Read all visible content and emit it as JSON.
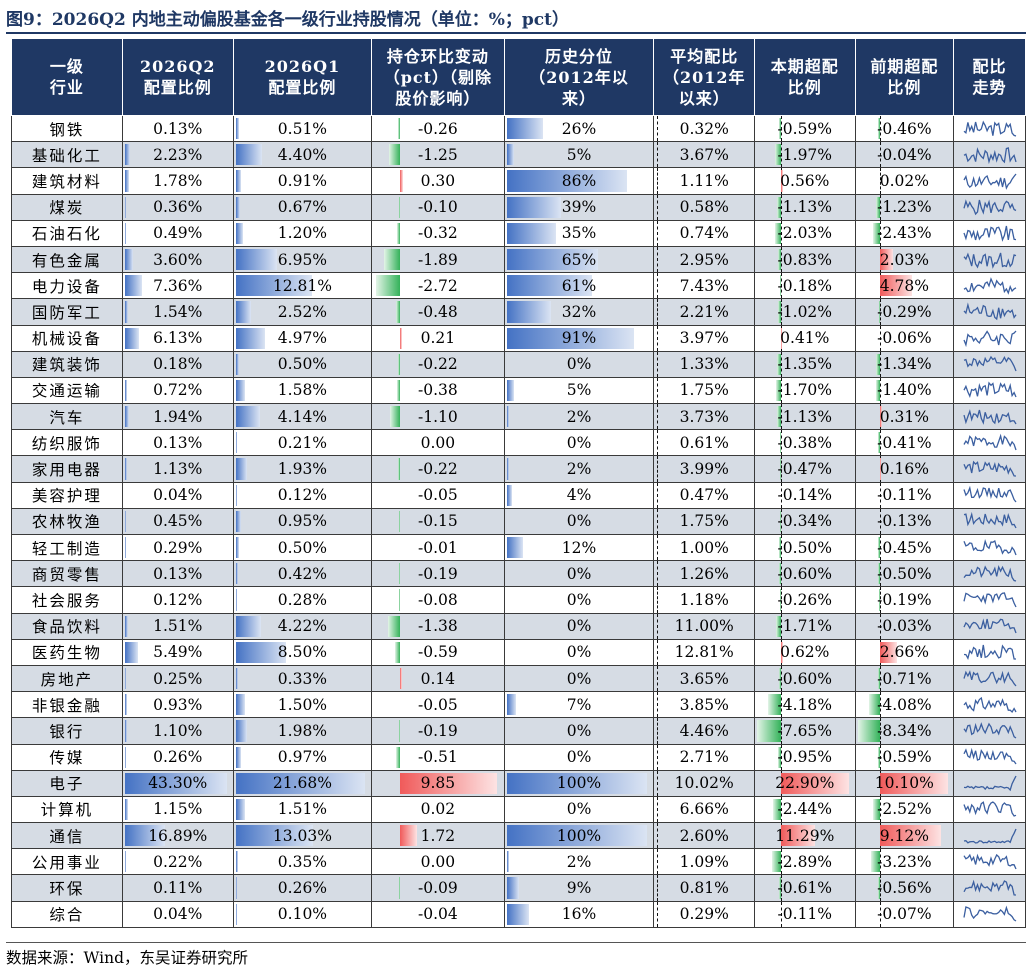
{
  "title": "图9：2026Q2 内地主动偏股基金各一级行业持股情况（单位：%；pct）",
  "source": "数据来源：Wind，东吴证券研究所",
  "headers": [
    "一级\n行业",
    "2026Q2\n配置比例",
    "2026Q1\n配置比例",
    "持仓环比变动\n（pct）（剔除\n股价影响）",
    "历史分位\n（2012年以\n来）",
    "平均配比\n（2012年\n以来）",
    "本期超配\n比例",
    "前期超配\n比例",
    "配比\n走势"
  ],
  "colors": {
    "header": "#1f3864",
    "alt_row": "#d6dce4",
    "bar_blue": "#4472c4",
    "bar_green": "#34b25a",
    "bar_red": "#f05a5a",
    "spark": "#3b5fa0"
  },
  "rows": [
    {
      "industry": "钢铁",
      "q2": "0.13%",
      "q1": "0.51%",
      "chg": "-0.26",
      "pct": "26%",
      "avg": "0.32%",
      "over": "-0.59%",
      "prev": "-0.46%",
      "q2_v": 0.13,
      "q1_v": 0.51,
      "chg_v": -0.26,
      "pct_v": 26,
      "avg_v": 0.32,
      "over_v": -0.59,
      "prev_v": -0.46
    },
    {
      "industry": "基础化工",
      "q2": "2.23%",
      "q1": "4.40%",
      "chg": "-1.25",
      "pct": "5%",
      "avg": "3.67%",
      "over": "-1.97%",
      "prev": "-0.04%",
      "q2_v": 2.23,
      "q1_v": 4.4,
      "chg_v": -1.25,
      "pct_v": 5,
      "avg_v": 3.67,
      "over_v": -1.97,
      "prev_v": -0.04
    },
    {
      "industry": "建筑材料",
      "q2": "1.78%",
      "q1": "0.91%",
      "chg": "0.30",
      "pct": "86%",
      "avg": "1.11%",
      "over": "0.56%",
      "prev": "0.02%",
      "q2_v": 1.78,
      "q1_v": 0.91,
      "chg_v": 0.3,
      "pct_v": 86,
      "avg_v": 1.11,
      "over_v": 0.56,
      "prev_v": 0.02
    },
    {
      "industry": "煤炭",
      "q2": "0.36%",
      "q1": "0.67%",
      "chg": "-0.10",
      "pct": "39%",
      "avg": "0.58%",
      "over": "-1.13%",
      "prev": "-1.23%",
      "q2_v": 0.36,
      "q1_v": 0.67,
      "chg_v": -0.1,
      "pct_v": 39,
      "avg_v": 0.58,
      "over_v": -1.13,
      "prev_v": -1.23
    },
    {
      "industry": "石油石化",
      "q2": "0.49%",
      "q1": "1.20%",
      "chg": "-0.32",
      "pct": "35%",
      "avg": "0.74%",
      "over": "-2.03%",
      "prev": "-2.43%",
      "q2_v": 0.49,
      "q1_v": 1.2,
      "chg_v": -0.32,
      "pct_v": 35,
      "avg_v": 0.74,
      "over_v": -2.03,
      "prev_v": -2.43
    },
    {
      "industry": "有色金属",
      "q2": "3.60%",
      "q1": "6.95%",
      "chg": "-1.89",
      "pct": "65%",
      "avg": "2.95%",
      "over": "-0.83%",
      "prev": "2.03%",
      "q2_v": 3.6,
      "q1_v": 6.95,
      "chg_v": -1.89,
      "pct_v": 65,
      "avg_v": 2.95,
      "over_v": -0.83,
      "prev_v": 2.03
    },
    {
      "industry": "电力设备",
      "q2": "7.36%",
      "q1": "12.81%",
      "chg": "-2.72",
      "pct": "61%",
      "avg": "7.43%",
      "over": "-0.18%",
      "prev": "4.78%",
      "q2_v": 7.36,
      "q1_v": 12.81,
      "chg_v": -2.72,
      "pct_v": 61,
      "avg_v": 7.43,
      "over_v": -0.18,
      "prev_v": 4.78
    },
    {
      "industry": "国防军工",
      "q2": "1.54%",
      "q1": "2.52%",
      "chg": "-0.48",
      "pct": "32%",
      "avg": "2.21%",
      "over": "-1.02%",
      "prev": "-0.29%",
      "q2_v": 1.54,
      "q1_v": 2.52,
      "chg_v": -0.48,
      "pct_v": 32,
      "avg_v": 2.21,
      "over_v": -1.02,
      "prev_v": -0.29
    },
    {
      "industry": "机械设备",
      "q2": "6.13%",
      "q1": "4.97%",
      "chg": "0.21",
      "pct": "91%",
      "avg": "3.97%",
      "over": "0.41%",
      "prev": "-0.06%",
      "q2_v": 6.13,
      "q1_v": 4.97,
      "chg_v": 0.21,
      "pct_v": 91,
      "avg_v": 3.97,
      "over_v": 0.41,
      "prev_v": -0.06
    },
    {
      "industry": "建筑装饰",
      "q2": "0.18%",
      "q1": "0.50%",
      "chg": "-0.22",
      "pct": "0%",
      "avg": "1.33%",
      "over": "-1.35%",
      "prev": "-1.34%",
      "q2_v": 0.18,
      "q1_v": 0.5,
      "chg_v": -0.22,
      "pct_v": 0,
      "avg_v": 1.33,
      "over_v": -1.35,
      "prev_v": -1.34
    },
    {
      "industry": "交通运输",
      "q2": "0.72%",
      "q1": "1.58%",
      "chg": "-0.38",
      "pct": "5%",
      "avg": "1.75%",
      "over": "-1.70%",
      "prev": "-1.40%",
      "q2_v": 0.72,
      "q1_v": 1.58,
      "chg_v": -0.38,
      "pct_v": 5,
      "avg_v": 1.75,
      "over_v": -1.7,
      "prev_v": -1.4
    },
    {
      "industry": "汽车",
      "q2": "1.94%",
      "q1": "4.14%",
      "chg": "-1.10",
      "pct": "2%",
      "avg": "3.73%",
      "over": "-1.13%",
      "prev": "0.31%",
      "q2_v": 1.94,
      "q1_v": 4.14,
      "chg_v": -1.1,
      "pct_v": 2,
      "avg_v": 3.73,
      "over_v": -1.13,
      "prev_v": 0.31
    },
    {
      "industry": "纺织服饰",
      "q2": "0.13%",
      "q1": "0.21%",
      "chg": "0.00",
      "pct": "0%",
      "avg": "0.61%",
      "over": "-0.38%",
      "prev": "-0.41%",
      "q2_v": 0.13,
      "q1_v": 0.21,
      "chg_v": 0.0,
      "pct_v": 0,
      "avg_v": 0.61,
      "over_v": -0.38,
      "prev_v": -0.41
    },
    {
      "industry": "家用电器",
      "q2": "1.13%",
      "q1": "1.93%",
      "chg": "-0.22",
      "pct": "2%",
      "avg": "3.99%",
      "over": "-0.47%",
      "prev": "0.16%",
      "q2_v": 1.13,
      "q1_v": 1.93,
      "chg_v": -0.22,
      "pct_v": 2,
      "avg_v": 3.99,
      "over_v": -0.47,
      "prev_v": 0.16
    },
    {
      "industry": "美容护理",
      "q2": "0.04%",
      "q1": "0.12%",
      "chg": "-0.05",
      "pct": "4%",
      "avg": "0.47%",
      "over": "-0.14%",
      "prev": "-0.11%",
      "q2_v": 0.04,
      "q1_v": 0.12,
      "chg_v": -0.05,
      "pct_v": 4,
      "avg_v": 0.47,
      "over_v": -0.14,
      "prev_v": -0.11
    },
    {
      "industry": "农林牧渔",
      "q2": "0.45%",
      "q1": "0.95%",
      "chg": "-0.15",
      "pct": "0%",
      "avg": "1.75%",
      "over": "-0.34%",
      "prev": "-0.13%",
      "q2_v": 0.45,
      "q1_v": 0.95,
      "chg_v": -0.15,
      "pct_v": 0,
      "avg_v": 1.75,
      "over_v": -0.34,
      "prev_v": -0.13
    },
    {
      "industry": "轻工制造",
      "q2": "0.29%",
      "q1": "0.50%",
      "chg": "-0.01",
      "pct": "12%",
      "avg": "1.00%",
      "over": "-0.50%",
      "prev": "-0.45%",
      "q2_v": 0.29,
      "q1_v": 0.5,
      "chg_v": -0.01,
      "pct_v": 12,
      "avg_v": 1.0,
      "over_v": -0.5,
      "prev_v": -0.45
    },
    {
      "industry": "商贸零售",
      "q2": "0.13%",
      "q1": "0.42%",
      "chg": "-0.19",
      "pct": "0%",
      "avg": "1.26%",
      "over": "-0.60%",
      "prev": "-0.50%",
      "q2_v": 0.13,
      "q1_v": 0.42,
      "chg_v": -0.19,
      "pct_v": 0,
      "avg_v": 1.26,
      "over_v": -0.6,
      "prev_v": -0.5
    },
    {
      "industry": "社会服务",
      "q2": "0.12%",
      "q1": "0.28%",
      "chg": "-0.08",
      "pct": "0%",
      "avg": "1.18%",
      "over": "-0.26%",
      "prev": "-0.19%",
      "q2_v": 0.12,
      "q1_v": 0.28,
      "chg_v": -0.08,
      "pct_v": 0,
      "avg_v": 1.18,
      "over_v": -0.26,
      "prev_v": -0.19
    },
    {
      "industry": "食品饮料",
      "q2": "1.51%",
      "q1": "4.22%",
      "chg": "-1.38",
      "pct": "0%",
      "avg": "11.00%",
      "over": "-1.71%",
      "prev": "-0.03%",
      "q2_v": 1.51,
      "q1_v": 4.22,
      "chg_v": -1.38,
      "pct_v": 0,
      "avg_v": 11.0,
      "over_v": -1.71,
      "prev_v": -0.03
    },
    {
      "industry": "医药生物",
      "q2": "5.49%",
      "q1": "8.50%",
      "chg": "-0.59",
      "pct": "0%",
      "avg": "12.81%",
      "over": "0.62%",
      "prev": "2.66%",
      "q2_v": 5.49,
      "q1_v": 8.5,
      "chg_v": -0.59,
      "pct_v": 0,
      "avg_v": 12.81,
      "over_v": 0.62,
      "prev_v": 2.66
    },
    {
      "industry": "房地产",
      "q2": "0.25%",
      "q1": "0.33%",
      "chg": "0.14",
      "pct": "0%",
      "avg": "3.65%",
      "over": "-0.60%",
      "prev": "-0.71%",
      "q2_v": 0.25,
      "q1_v": 0.33,
      "chg_v": 0.14,
      "pct_v": 0,
      "avg_v": 3.65,
      "over_v": -0.6,
      "prev_v": -0.71
    },
    {
      "industry": "非银金融",
      "q2": "0.93%",
      "q1": "1.50%",
      "chg": "-0.05",
      "pct": "7%",
      "avg": "3.85%",
      "over": "-4.18%",
      "prev": "-4.08%",
      "q2_v": 0.93,
      "q1_v": 1.5,
      "chg_v": -0.05,
      "pct_v": 7,
      "avg_v": 3.85,
      "over_v": -4.18,
      "prev_v": -4.08
    },
    {
      "industry": "银行",
      "q2": "1.10%",
      "q1": "1.98%",
      "chg": "-0.19",
      "pct": "0%",
      "avg": "4.46%",
      "over": "-7.65%",
      "prev": "-8.34%",
      "q2_v": 1.1,
      "q1_v": 1.98,
      "chg_v": -0.19,
      "pct_v": 0,
      "avg_v": 4.46,
      "over_v": -7.65,
      "prev_v": -8.34
    },
    {
      "industry": "传媒",
      "q2": "0.26%",
      "q1": "0.97%",
      "chg": "-0.51",
      "pct": "0%",
      "avg": "2.71%",
      "over": "-0.95%",
      "prev": "-0.59%",
      "q2_v": 0.26,
      "q1_v": 0.97,
      "chg_v": -0.51,
      "pct_v": 0,
      "avg_v": 2.71,
      "over_v": -0.95,
      "prev_v": -0.59
    },
    {
      "industry": "电子",
      "q2": "43.30%",
      "q1": "21.68%",
      "chg": "9.85",
      "pct": "100%",
      "avg": "10.02%",
      "over": "22.90%",
      "prev": "10.10%",
      "q2_v": 43.3,
      "q1_v": 21.68,
      "chg_v": 9.85,
      "pct_v": 100,
      "avg_v": 10.02,
      "over_v": 22.9,
      "prev_v": 10.1
    },
    {
      "industry": "计算机",
      "q2": "1.15%",
      "q1": "1.51%",
      "chg": "0.02",
      "pct": "0%",
      "avg": "6.66%",
      "over": "-2.44%",
      "prev": "-2.52%",
      "q2_v": 1.15,
      "q1_v": 1.51,
      "chg_v": 0.02,
      "pct_v": 0,
      "avg_v": 6.66,
      "over_v": -2.44,
      "prev_v": -2.52
    },
    {
      "industry": "通信",
      "q2": "16.89%",
      "q1": "13.03%",
      "chg": "1.72",
      "pct": "100%",
      "avg": "2.60%",
      "over": "11.29%",
      "prev": "9.12%",
      "q2_v": 16.89,
      "q1_v": 13.03,
      "chg_v": 1.72,
      "pct_v": 100,
      "avg_v": 2.6,
      "over_v": 11.29,
      "prev_v": 9.12
    },
    {
      "industry": "公用事业",
      "q2": "0.22%",
      "q1": "0.35%",
      "chg": "0.00",
      "pct": "2%",
      "avg": "1.09%",
      "over": "-2.89%",
      "prev": "-3.23%",
      "q2_v": 0.22,
      "q1_v": 0.35,
      "chg_v": 0.0,
      "pct_v": 2,
      "avg_v": 1.09,
      "over_v": -2.89,
      "prev_v": -3.23
    },
    {
      "industry": "环保",
      "q2": "0.11%",
      "q1": "0.26%",
      "chg": "-0.09",
      "pct": "9%",
      "avg": "0.81%",
      "over": "-0.61%",
      "prev": "-0.56%",
      "q2_v": 0.11,
      "q1_v": 0.26,
      "chg_v": -0.09,
      "pct_v": 9,
      "avg_v": 0.81,
      "over_v": -0.61,
      "prev_v": -0.56
    },
    {
      "industry": "综合",
      "q2": "0.04%",
      "q1": "0.10%",
      "chg": "-0.04",
      "pct": "16%",
      "avg": "0.29%",
      "over": "-0.11%",
      "prev": "-0.07%",
      "q2_v": 0.04,
      "q1_v": 0.1,
      "chg_v": -0.04,
      "pct_v": 16,
      "avg_v": 0.29,
      "over_v": -0.11,
      "prev_v": -0.07
    }
  ]
}
